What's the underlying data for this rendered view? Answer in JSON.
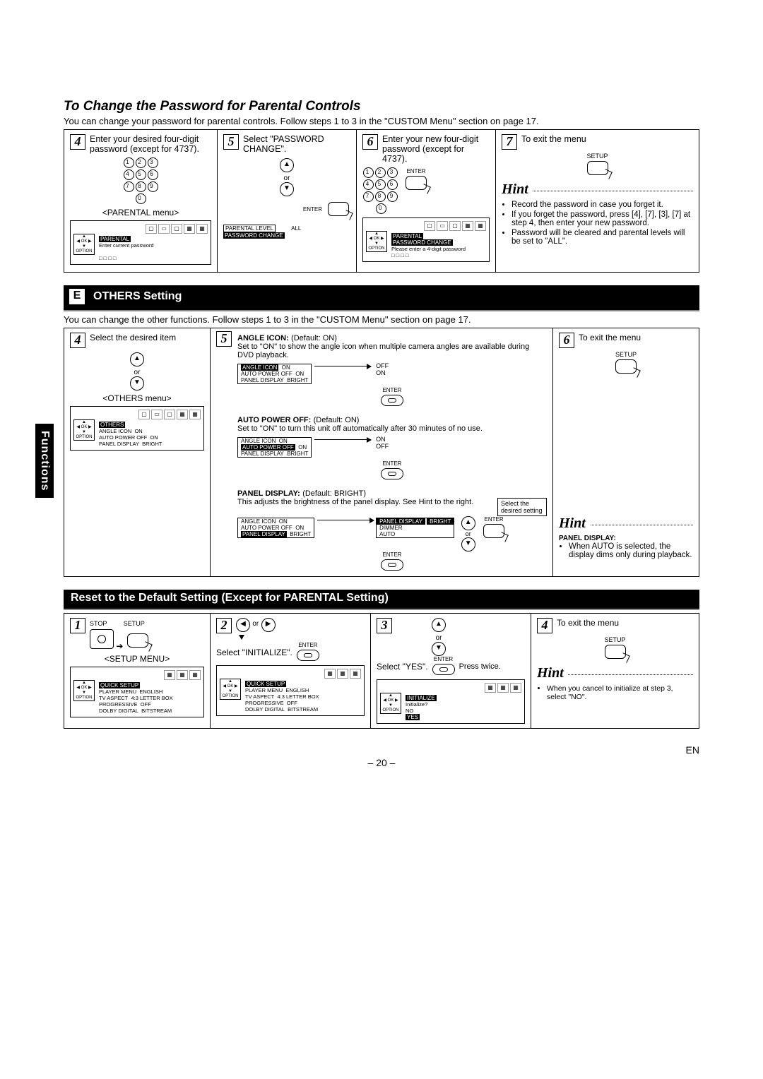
{
  "title": "To Change the Password for Parental Controls",
  "intro": "You can change your password for parental controls.  Follow steps 1 to 3 in the \"CUSTOM Menu\" section on page 17.",
  "parental": {
    "step4": {
      "num": "4",
      "text": "Enter your desired four-digit password (except for 4737).",
      "keypad": [
        "1",
        "2",
        "3",
        "4",
        "5",
        "6",
        "7",
        "8",
        "9",
        "0"
      ],
      "menulabel": "<PARENTAL menu>",
      "menu_title": "PARENTAL",
      "menu_text": "Enter current password",
      "menu_footer": "□ □ □ □",
      "dpad_lbl": "OPTION"
    },
    "step5": {
      "num": "5",
      "text": "Select \"PASSWORD CHANGE\".",
      "box1": "PARENTAL LEVEL",
      "box1v": "ALL",
      "box2": "PASSWORD CHANGE",
      "enter": "ENTER",
      "or": "or"
    },
    "step6": {
      "num": "6",
      "text": "Enter your new four-digit password (except for 4737).",
      "keypad": [
        "1",
        "2",
        "3",
        "4",
        "5",
        "6",
        "7",
        "8",
        "9",
        "0"
      ],
      "enter": "ENTER",
      "menu_title": "PARENTAL",
      "menu_sub": "PASSWORD CHANGE",
      "menu_text": "Please enter a 4-digit password",
      "menu_footer": "□ □ □ □",
      "dpad_lbl": "OPTION"
    },
    "step7": {
      "num": "7",
      "text": "To exit the menu",
      "btn": "SETUP"
    },
    "hint": {
      "title": "Hint",
      "items": [
        "Record the password in case you forget it.",
        "If you forget the password, press [4], [7], [3], [7] at step 4, then enter your new password.",
        "Password will be cleared and parental levels will be set to \"ALL\"."
      ]
    }
  },
  "others": {
    "letter": "E",
    "title": "OTHERS Setting",
    "intro": "You can change the other functions. Follow steps 1 to 3 in the \"CUSTOM Menu\" section on page 17.",
    "step4": {
      "num": "4",
      "text": "Select the desired item",
      "or": "or",
      "menulabel": "<OTHERS menu>",
      "menu_title": "OTHERS",
      "rows": [
        [
          "ANGLE ICON",
          "ON"
        ],
        [
          "AUTO POWER OFF",
          "ON"
        ],
        [
          "PANEL DISPLAY",
          "BRIGHT"
        ]
      ],
      "dpad_lbl": "OPTION"
    },
    "step5": {
      "num": "5",
      "angle": {
        "title": "ANGLE ICON:",
        "default": "(Default: ON)",
        "desc": "Set to \"ON\" to show the angle icon when multiple camera angles are available during DVD playback.",
        "rows": [
          [
            "ANGLE ICON",
            "ON"
          ],
          [
            "AUTO POWER OFF",
            "ON"
          ],
          [
            "PANEL DISPLAY",
            "BRIGHT"
          ]
        ],
        "opts": [
          "OFF",
          "ON"
        ],
        "enter": "ENTER"
      },
      "autopower": {
        "title": "AUTO POWER OFF:",
        "default": "(Default: ON)",
        "desc": "Set to \"ON\" to turn this unit off automatically after 30 minutes of no use.",
        "rows": [
          [
            "ANGLE ICON",
            "ON"
          ],
          [
            "AUTO POWER OFF",
            "ON"
          ],
          [
            "PANEL DISPLAY",
            "BRIGHT"
          ]
        ],
        "opts": [
          "ON",
          "OFF"
        ],
        "enter": "ENTER"
      },
      "panel": {
        "title": "PANEL DISPLAY:",
        "default": "(Default: BRIGHT)",
        "desc": "This adjusts the brightness of the panel display. See Hint to the right.",
        "rows": [
          [
            "ANGLE ICON",
            "ON"
          ],
          [
            "AUTO POWER OFF",
            "ON"
          ],
          [
            "PANEL DISPLAY",
            "BRIGHT"
          ]
        ],
        "panelopts": [
          "PANEL DISPLAY",
          "BRIGHT",
          "DIMMER",
          "AUTO"
        ],
        "enter": "ENTER",
        "note": "Select the desired setting",
        "or": "or"
      }
    },
    "step6": {
      "num": "6",
      "text": "To exit the menu",
      "btn": "SETUP"
    },
    "hint": {
      "title": "Hint",
      "subtitle": "PANEL DISPLAY:",
      "items": [
        "When AUTO is selected, the display dims only during playback."
      ]
    }
  },
  "reset": {
    "title": "Reset to the Default Setting (Except for PARENTAL Setting)",
    "step1": {
      "num": "1",
      "stop": "STOP",
      "setup": "SETUP",
      "menulabel": "<SETUP MENU>",
      "menu_title": "QUICK SETUP",
      "rows": [
        [
          "PLAYER MENU",
          "ENGLISH"
        ],
        [
          "TV ASPECT",
          "4:3 LETTER BOX"
        ],
        [
          "PROGRESSIVE",
          "OFF"
        ],
        [
          "DOLBY DIGITAL",
          "BITSTREAM"
        ]
      ],
      "dpad_lbl": "OPTION"
    },
    "step2": {
      "num": "2",
      "text": "Select \"INITIALIZE\".",
      "or": "or",
      "enter": "ENTER",
      "menu_title": "QUICK SETUP",
      "rows": [
        [
          "PLAYER MENU",
          "ENGLISH"
        ],
        [
          "TV ASPECT",
          "4:3 LETTER BOX"
        ],
        [
          "PROGRESSIVE",
          "OFF"
        ],
        [
          "DOLBY DIGITAL",
          "BITSTREAM"
        ]
      ],
      "dpad_lbl": "OPTION"
    },
    "step3": {
      "num": "3",
      "text": "Select \"YES\".",
      "or": "or",
      "enter": "ENTER",
      "menu_title": "INITIALIZE",
      "prompt": "Initialize?",
      "opts": [
        "NO",
        "YES"
      ],
      "press": "Press twice.",
      "dpad_lbl": "OPTION"
    },
    "step4": {
      "num": "4",
      "text": "To exit the menu",
      "btn": "SETUP"
    },
    "hint": {
      "title": "Hint",
      "items": [
        "When you cancel to initialize at step 3, select \"NO\"."
      ]
    }
  },
  "sidetab": "Functions",
  "pagenum": "– 20 –",
  "lang": "EN"
}
